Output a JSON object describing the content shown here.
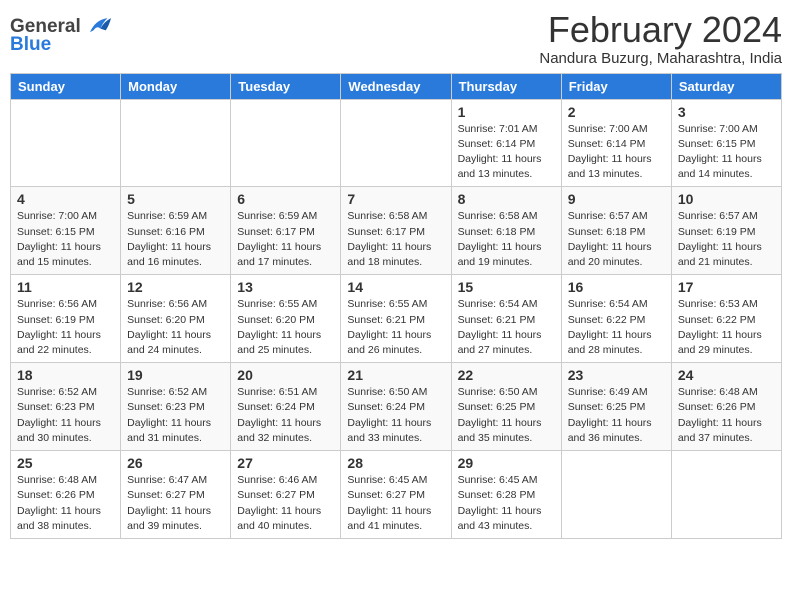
{
  "header": {
    "logo_general": "General",
    "logo_blue": "Blue",
    "month_year": "February 2024",
    "location": "Nandura Buzurg, Maharashtra, India"
  },
  "days_of_week": [
    "Sunday",
    "Monday",
    "Tuesday",
    "Wednesday",
    "Thursday",
    "Friday",
    "Saturday"
  ],
  "weeks": [
    [
      {
        "day": "",
        "info": ""
      },
      {
        "day": "",
        "info": ""
      },
      {
        "day": "",
        "info": ""
      },
      {
        "day": "",
        "info": ""
      },
      {
        "day": "1",
        "info": "Sunrise: 7:01 AM\nSunset: 6:14 PM\nDaylight: 11 hours and 13 minutes."
      },
      {
        "day": "2",
        "info": "Sunrise: 7:00 AM\nSunset: 6:14 PM\nDaylight: 11 hours and 13 minutes."
      },
      {
        "day": "3",
        "info": "Sunrise: 7:00 AM\nSunset: 6:15 PM\nDaylight: 11 hours and 14 minutes."
      }
    ],
    [
      {
        "day": "4",
        "info": "Sunrise: 7:00 AM\nSunset: 6:15 PM\nDaylight: 11 hours and 15 minutes."
      },
      {
        "day": "5",
        "info": "Sunrise: 6:59 AM\nSunset: 6:16 PM\nDaylight: 11 hours and 16 minutes."
      },
      {
        "day": "6",
        "info": "Sunrise: 6:59 AM\nSunset: 6:17 PM\nDaylight: 11 hours and 17 minutes."
      },
      {
        "day": "7",
        "info": "Sunrise: 6:58 AM\nSunset: 6:17 PM\nDaylight: 11 hours and 18 minutes."
      },
      {
        "day": "8",
        "info": "Sunrise: 6:58 AM\nSunset: 6:18 PM\nDaylight: 11 hours and 19 minutes."
      },
      {
        "day": "9",
        "info": "Sunrise: 6:57 AM\nSunset: 6:18 PM\nDaylight: 11 hours and 20 minutes."
      },
      {
        "day": "10",
        "info": "Sunrise: 6:57 AM\nSunset: 6:19 PM\nDaylight: 11 hours and 21 minutes."
      }
    ],
    [
      {
        "day": "11",
        "info": "Sunrise: 6:56 AM\nSunset: 6:19 PM\nDaylight: 11 hours and 22 minutes."
      },
      {
        "day": "12",
        "info": "Sunrise: 6:56 AM\nSunset: 6:20 PM\nDaylight: 11 hours and 24 minutes."
      },
      {
        "day": "13",
        "info": "Sunrise: 6:55 AM\nSunset: 6:20 PM\nDaylight: 11 hours and 25 minutes."
      },
      {
        "day": "14",
        "info": "Sunrise: 6:55 AM\nSunset: 6:21 PM\nDaylight: 11 hours and 26 minutes."
      },
      {
        "day": "15",
        "info": "Sunrise: 6:54 AM\nSunset: 6:21 PM\nDaylight: 11 hours and 27 minutes."
      },
      {
        "day": "16",
        "info": "Sunrise: 6:54 AM\nSunset: 6:22 PM\nDaylight: 11 hours and 28 minutes."
      },
      {
        "day": "17",
        "info": "Sunrise: 6:53 AM\nSunset: 6:22 PM\nDaylight: 11 hours and 29 minutes."
      }
    ],
    [
      {
        "day": "18",
        "info": "Sunrise: 6:52 AM\nSunset: 6:23 PM\nDaylight: 11 hours and 30 minutes."
      },
      {
        "day": "19",
        "info": "Sunrise: 6:52 AM\nSunset: 6:23 PM\nDaylight: 11 hours and 31 minutes."
      },
      {
        "day": "20",
        "info": "Sunrise: 6:51 AM\nSunset: 6:24 PM\nDaylight: 11 hours and 32 minutes."
      },
      {
        "day": "21",
        "info": "Sunrise: 6:50 AM\nSunset: 6:24 PM\nDaylight: 11 hours and 33 minutes."
      },
      {
        "day": "22",
        "info": "Sunrise: 6:50 AM\nSunset: 6:25 PM\nDaylight: 11 hours and 35 minutes."
      },
      {
        "day": "23",
        "info": "Sunrise: 6:49 AM\nSunset: 6:25 PM\nDaylight: 11 hours and 36 minutes."
      },
      {
        "day": "24",
        "info": "Sunrise: 6:48 AM\nSunset: 6:26 PM\nDaylight: 11 hours and 37 minutes."
      }
    ],
    [
      {
        "day": "25",
        "info": "Sunrise: 6:48 AM\nSunset: 6:26 PM\nDaylight: 11 hours and 38 minutes."
      },
      {
        "day": "26",
        "info": "Sunrise: 6:47 AM\nSunset: 6:27 PM\nDaylight: 11 hours and 39 minutes."
      },
      {
        "day": "27",
        "info": "Sunrise: 6:46 AM\nSunset: 6:27 PM\nDaylight: 11 hours and 40 minutes."
      },
      {
        "day": "28",
        "info": "Sunrise: 6:45 AM\nSunset: 6:27 PM\nDaylight: 11 hours and 41 minutes."
      },
      {
        "day": "29",
        "info": "Sunrise: 6:45 AM\nSunset: 6:28 PM\nDaylight: 11 hours and 43 minutes."
      },
      {
        "day": "",
        "info": ""
      },
      {
        "day": "",
        "info": ""
      }
    ]
  ]
}
